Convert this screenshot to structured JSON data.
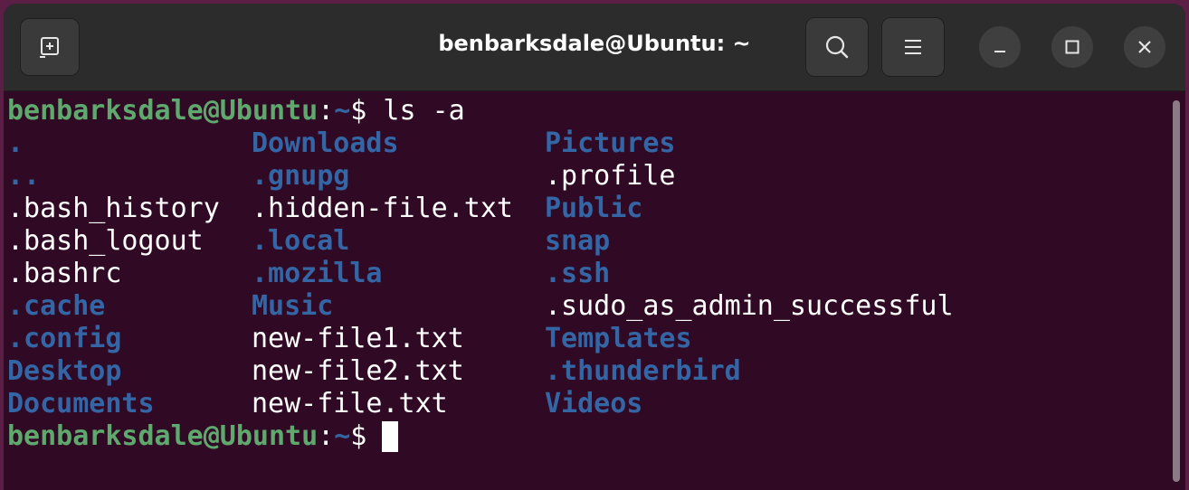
{
  "window": {
    "title": "benbarksdale@Ubuntu: ~"
  },
  "prompt": {
    "user_host": "benbarksdale@Ubuntu",
    "colon": ":",
    "path": "~",
    "symbol": "$ "
  },
  "command": "ls -a",
  "listing": {
    "col1": [
      {
        "name": ".",
        "type": "dir"
      },
      {
        "name": "..",
        "type": "dir"
      },
      {
        "name": ".bash_history",
        "type": "file"
      },
      {
        "name": ".bash_logout",
        "type": "file"
      },
      {
        "name": ".bashrc",
        "type": "file"
      },
      {
        "name": ".cache",
        "type": "dir"
      },
      {
        "name": ".config",
        "type": "dir"
      },
      {
        "name": "Desktop",
        "type": "dir"
      },
      {
        "name": "Documents",
        "type": "dir"
      }
    ],
    "col2": [
      {
        "name": "Downloads",
        "type": "dir"
      },
      {
        "name": ".gnupg",
        "type": "dir"
      },
      {
        "name": ".hidden-file.txt",
        "type": "file"
      },
      {
        "name": ".local",
        "type": "dir"
      },
      {
        "name": ".mozilla",
        "type": "dir"
      },
      {
        "name": "Music",
        "type": "dir"
      },
      {
        "name": "new-file1.txt",
        "type": "file"
      },
      {
        "name": "new-file2.txt",
        "type": "file"
      },
      {
        "name": "new-file.txt",
        "type": "file"
      }
    ],
    "col3": [
      {
        "name": "Pictures",
        "type": "dir"
      },
      {
        "name": ".profile",
        "type": "file"
      },
      {
        "name": "Public",
        "type": "dir"
      },
      {
        "name": "snap",
        "type": "dir"
      },
      {
        "name": ".ssh",
        "type": "dir"
      },
      {
        "name": ".sudo_as_admin_successful",
        "type": "file"
      },
      {
        "name": "Templates",
        "type": "dir"
      },
      {
        "name": ".thunderbird",
        "type": "dir"
      },
      {
        "name": "Videos",
        "type": "dir"
      }
    ]
  },
  "colors": {
    "background": "#300a24",
    "titlebar": "#2c2c2c",
    "prompt_user": "#5fa86e",
    "directory": "#3465a4",
    "text": "#ffffff"
  },
  "icons": {
    "new_tab": "new-tab-icon",
    "search": "search-icon",
    "menu": "hamburger-menu-icon",
    "minimize": "minimize-icon",
    "maximize": "maximize-icon",
    "close": "close-icon"
  }
}
